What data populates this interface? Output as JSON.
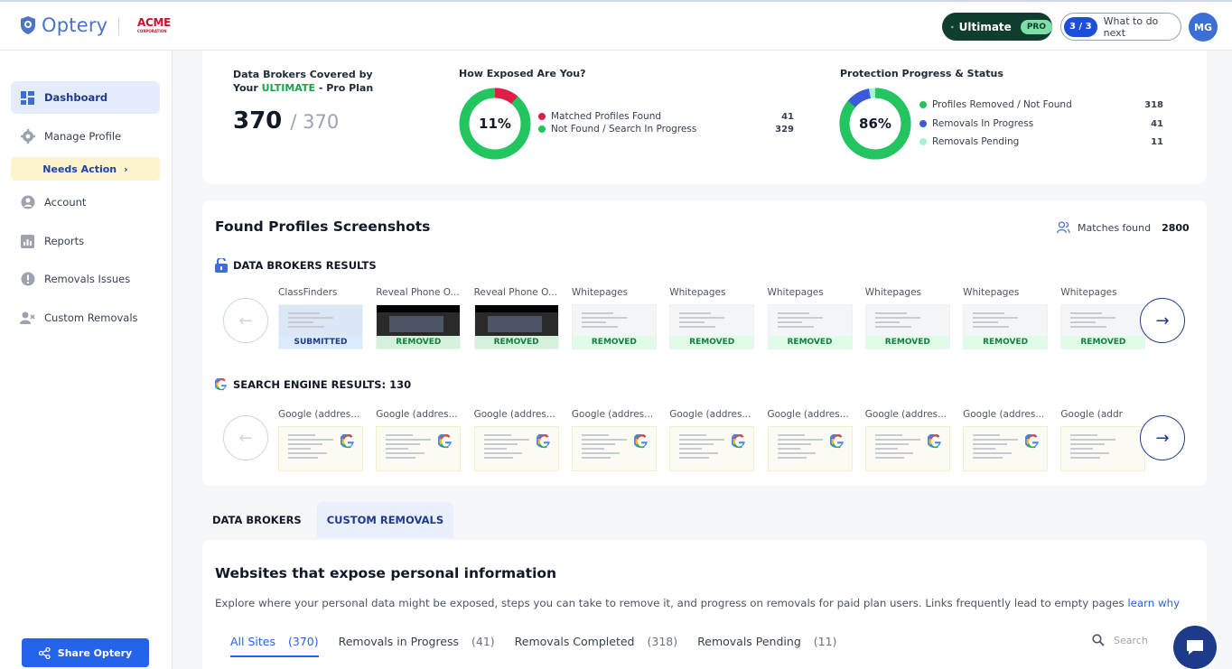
{
  "header": {
    "logo_text": "Optery",
    "partner_logo": "ACME",
    "partner_sub": "CORPORATION",
    "plan_label": "Ultimate",
    "plan_badge": "PRO",
    "steps_count": "3 / 3",
    "what_next_label": "What to do next",
    "avatar_initials": "MG"
  },
  "sidebar": {
    "items": [
      {
        "label": "Dashboard",
        "icon": "grid-icon"
      },
      {
        "label": "Manage Profile",
        "icon": "gear-icon"
      },
      {
        "label": "Account",
        "icon": "user-circle-icon"
      },
      {
        "label": "Reports",
        "icon": "chart-icon"
      },
      {
        "label": "Removals Issues",
        "icon": "alert-icon"
      },
      {
        "label": "Custom Removals",
        "icon": "user-x-icon"
      }
    ],
    "needs_action_label": "Needs Action",
    "share_label": "Share Optery"
  },
  "coverage": {
    "title_prefix": "Data Brokers Covered by Your",
    "title_plan": "ULTIMATE",
    "title_suffix": "- Pro Plan",
    "covered": "370",
    "total": "/ 370"
  },
  "exposure": {
    "title": "How Exposed Are You?",
    "percent_label": "11%",
    "percent_value": 11,
    "legend": [
      {
        "label": "Matched Profiles Found",
        "value": "41",
        "color": "#e11d48"
      },
      {
        "label": "Not Found / Search In Progress",
        "value": "329",
        "color": "#22c55e"
      }
    ]
  },
  "protection": {
    "title": "Protection Progress & Status",
    "percent_label": "86%",
    "slices": [
      86,
      11,
      3
    ],
    "legend": [
      {
        "label": "Profiles Removed / Not Found",
        "value": "318",
        "color": "#22c55e"
      },
      {
        "label": "Removals In Progress",
        "value": "41",
        "color": "#3b5bdb"
      },
      {
        "label": "Removals Pending",
        "value": "11",
        "color": "#a7f3d0"
      }
    ]
  },
  "screenshots": {
    "title": "Found Profiles Screenshots",
    "matches_label": "Matches found",
    "matches_count": "2800",
    "brokers_heading": "DATA BROKERS RESULTS",
    "search_heading": "SEARCH ENGINE RESULTS: 130",
    "brokers": [
      {
        "name": "ClassFinders",
        "status": "SUBMITTED"
      },
      {
        "name": "Reveal Phone O...",
        "status": "REMOVED"
      },
      {
        "name": "Reveal Phone O...",
        "status": "REMOVED"
      },
      {
        "name": "Whitepages",
        "status": "REMOVED"
      },
      {
        "name": "Whitepages",
        "status": "REMOVED"
      },
      {
        "name": "Whitepages",
        "status": "REMOVED"
      },
      {
        "name": "Whitepages",
        "status": "REMOVED"
      },
      {
        "name": "Whitepages",
        "status": "REMOVED"
      },
      {
        "name": "Whitepages",
        "status": "REMOVED"
      }
    ],
    "search_results": [
      {
        "name": "Google (addres..."
      },
      {
        "name": "Google (addres..."
      },
      {
        "name": "Google (addres..."
      },
      {
        "name": "Google (addres..."
      },
      {
        "name": "Google (addres..."
      },
      {
        "name": "Google (addres..."
      },
      {
        "name": "Google (addres..."
      },
      {
        "name": "Google (addres..."
      },
      {
        "name": "Google (addr"
      }
    ],
    "prev_arrow": "←",
    "next_arrow": "→"
  },
  "tabs": [
    {
      "label": "DATA BROKERS"
    },
    {
      "label": "CUSTOM REMOVALS"
    }
  ],
  "sites": {
    "title": "Websites that expose personal information",
    "description": "Explore where your personal data might be exposed, steps you can take to remove it, and progress on removals for paid plan users. Links frequently lead to empty pages",
    "learn_link": "learn why",
    "filters": [
      {
        "label": "All Sites",
        "count": "(370)"
      },
      {
        "label": "Removals in Progress",
        "count": "(41)"
      },
      {
        "label": "Removals Completed",
        "count": "(318)"
      },
      {
        "label": "Removals Pending",
        "count": "(11)"
      }
    ],
    "search_placeholder": "Search"
  }
}
